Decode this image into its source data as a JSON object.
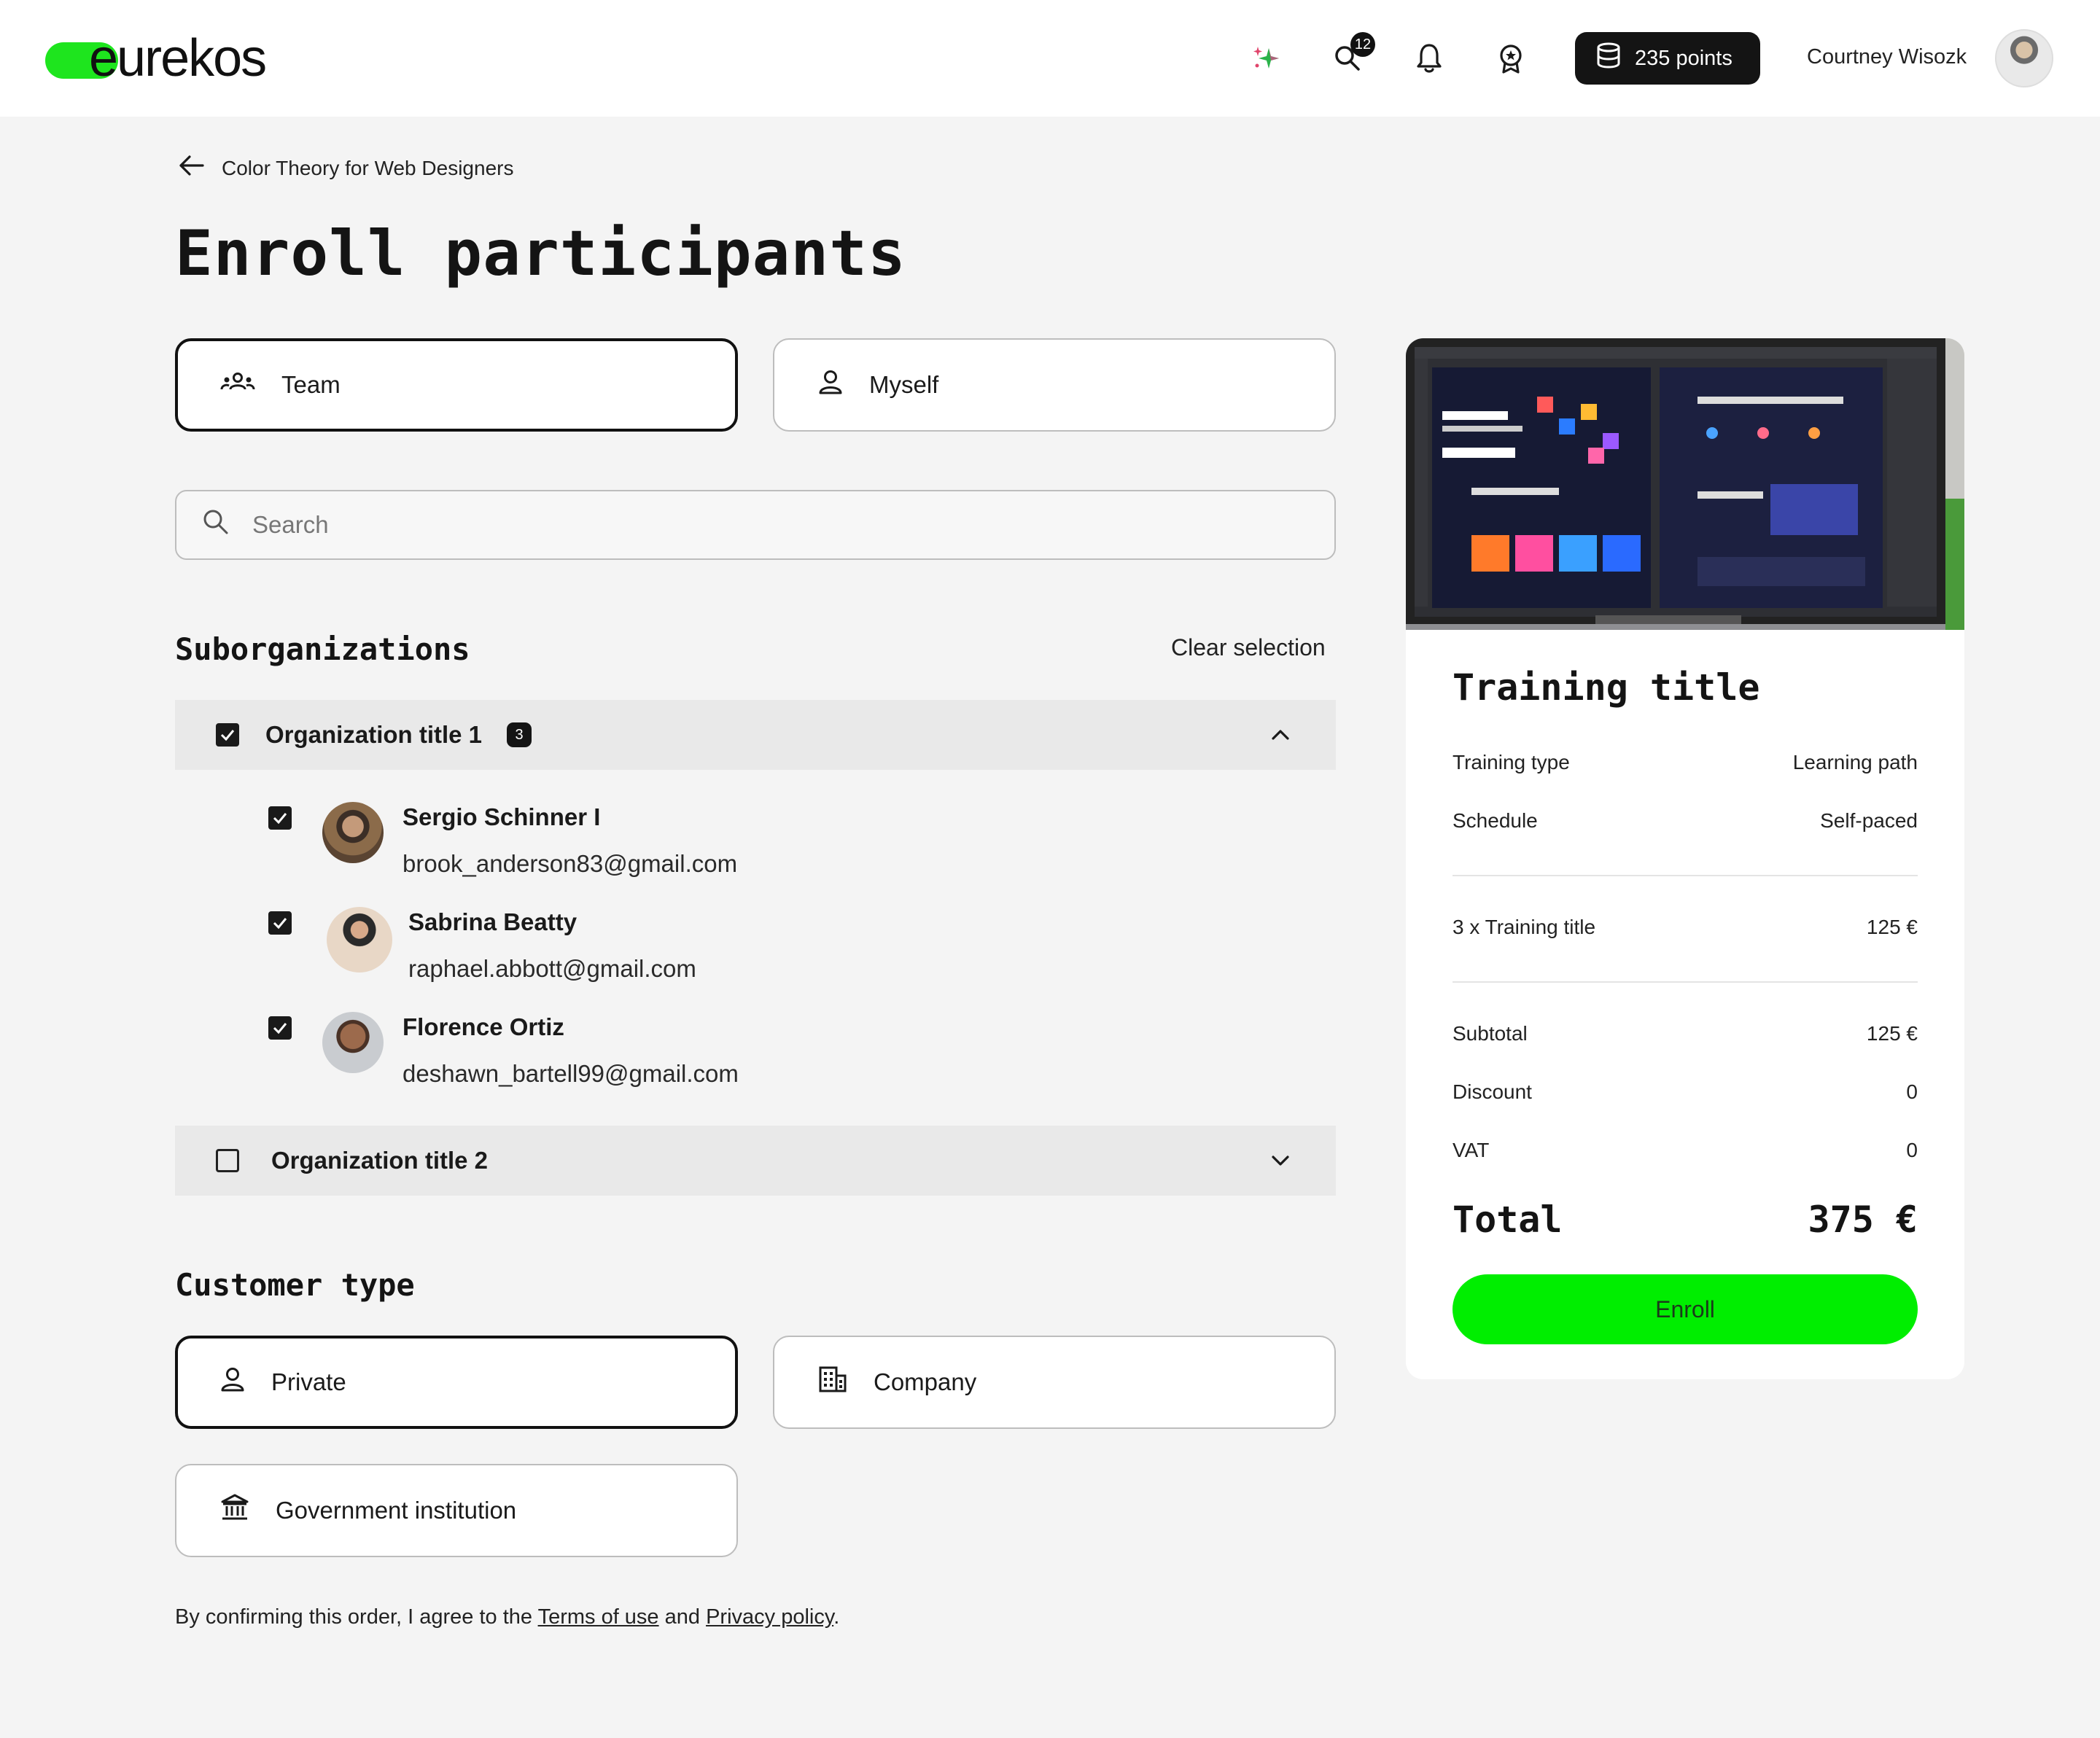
{
  "header": {
    "logo_text": "eurekos",
    "search_badge": "12",
    "points_label": "235 points",
    "user_name": "Courtney Wisozk",
    "accent_color": "#00ee00"
  },
  "breadcrumb": {
    "back_label": "Color Theory for Web Designers"
  },
  "page": {
    "title": "Enroll participants"
  },
  "audience": {
    "options": [
      {
        "label": "Team",
        "icon": "team-icon",
        "selected": true
      },
      {
        "label": "Myself",
        "icon": "user-icon",
        "selected": false
      }
    ]
  },
  "search": {
    "placeholder": "Search"
  },
  "suborganizations": {
    "title": "Suborganizations",
    "clear_label": "Clear selection",
    "orgs": [
      {
        "label": "Organization title 1",
        "count": "3",
        "checked": true,
        "expanded": true,
        "members": [
          {
            "name": "Sergio Schinner I",
            "email": "brook_anderson83@gmail.com",
            "checked": true
          },
          {
            "name": "Sabrina Beatty",
            "email": "raphael.abbott@gmail.com",
            "checked": true
          },
          {
            "name": "Florence Ortiz",
            "email": "deshawn_bartell99@gmail.com",
            "checked": true
          }
        ]
      },
      {
        "label": "Organization title 2",
        "checked": false,
        "expanded": false
      }
    ]
  },
  "customer_type": {
    "title": "Customer type",
    "options": [
      {
        "label": "Private",
        "icon": "user-icon",
        "selected": true
      },
      {
        "label": "Company",
        "icon": "building-icon",
        "selected": false
      },
      {
        "label": "Government institution",
        "icon": "institution-icon",
        "selected": false
      }
    ]
  },
  "terms": {
    "prefix": "By confirming this order, I agree to the ",
    "terms_link": "Terms of use",
    "middle": " and ",
    "privacy_link": "Privacy policy",
    "suffix": "."
  },
  "summary": {
    "title": "Training title",
    "training_type_label": "Training type",
    "training_type_value": "Learning path",
    "schedule_label": "Schedule",
    "schedule_value": "Self-paced",
    "line_item_label": "3 x Training title",
    "line_item_value": "125 €",
    "subtotal_label": "Subtotal",
    "subtotal_value": "125 €",
    "discount_label": "Discount",
    "discount_value": "0",
    "vat_label": "VAT",
    "vat_value": "0",
    "total_label": "Total",
    "total_value": "375 €",
    "enroll_label": "Enroll"
  }
}
